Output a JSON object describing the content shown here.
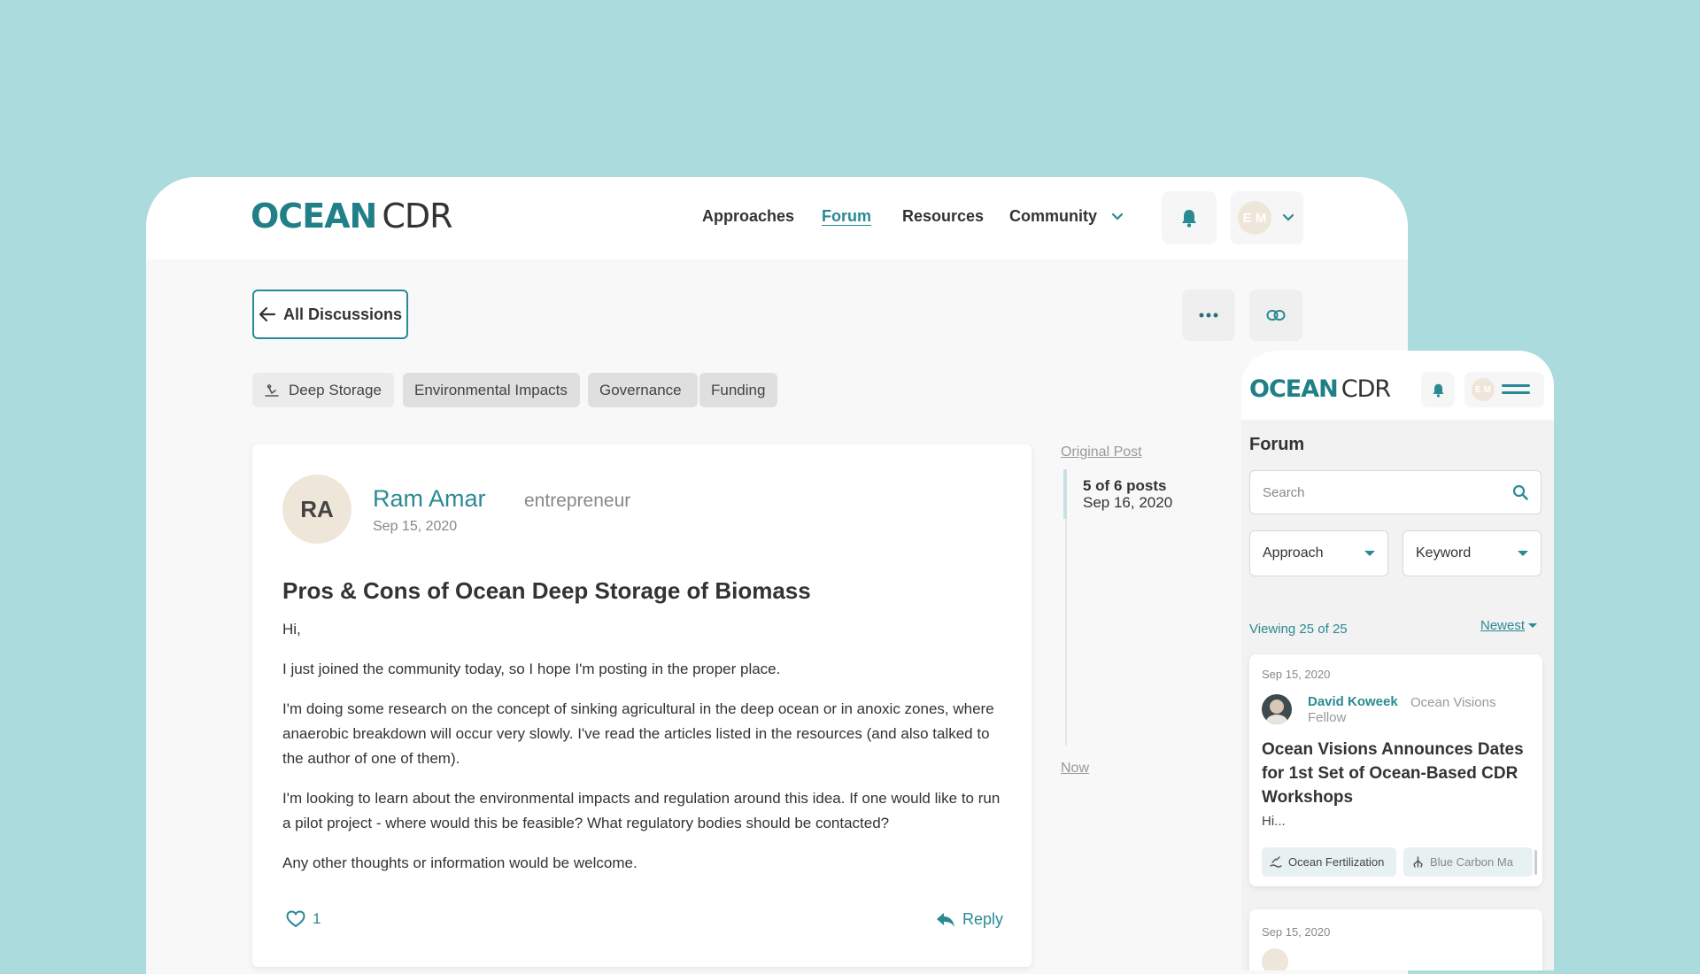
{
  "header": {
    "logo_ocean": "OCEAN",
    "logo_cdr": "CDR",
    "nav": {
      "approaches": "Approaches",
      "forum": "Forum",
      "resources": "Resources",
      "community": "Community"
    },
    "avatar_initials": "E M"
  },
  "toolbar": {
    "back_label": "All Discussions"
  },
  "tags": [
    "Deep Storage",
    "Environmental Impacts",
    "Governance",
    "Funding"
  ],
  "post": {
    "avatar_initials": "RA",
    "author": "Ram Amar",
    "role": "entrepreneur",
    "date": "Sep 15, 2020",
    "title": "Pros & Cons of Ocean Deep Storage of Biomass",
    "paragraphs": [
      "Hi,",
      "I just joined the community today, so I hope I'm posting in the proper place.",
      "I'm doing some research on the concept of sinking agricultural in the deep ocean or in anoxic zones, where anaerobic breakdown will occur very slowly. I've read the articles listed in the resources (and also talked to the author of one of them).",
      "I'm looking to learn about the environmental impacts and regulation around this idea. If one would like to run a pilot project - where would this be feasible? What regulatory bodies should be contacted?",
      "Any other thoughts or information would be welcome."
    ],
    "like_count": "1",
    "reply_label": "Reply"
  },
  "timeline": {
    "original_label": "Original Post",
    "position": "5 of 6 posts",
    "date": "Sep 16, 2020",
    "now_label": "Now"
  },
  "mobile": {
    "logo_ocean": "OCEAN",
    "logo_cdr": "CDR",
    "avatar_initials": "E M",
    "section_title": "Forum",
    "search_placeholder": "Search",
    "filter_approach": "Approach",
    "filter_keyword": "Keyword",
    "viewing": "Viewing 25 of 25",
    "sort": "Newest",
    "card1": {
      "date": "Sep 15, 2020",
      "author": "David Koweek",
      "org": "Ocean Visions",
      "role": "Fellow",
      "title": "Ocean Visions Announces Dates for 1st Set of Ocean-Based CDR Workshops",
      "excerpt": "Hi...",
      "tags": [
        "Ocean Fertilization",
        "Blue Carbon Ma"
      ]
    },
    "card2": {
      "date": "Sep 15, 2020"
    }
  },
  "colors": {
    "accent": "#2a8a93",
    "background": "#abdbdc",
    "tag_bg": "#dfdfdf"
  }
}
